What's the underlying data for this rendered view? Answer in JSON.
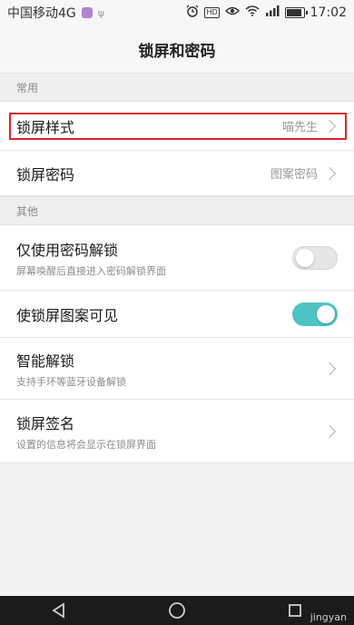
{
  "status_bar": {
    "carrier": "中国移动4G",
    "time": "17:02"
  },
  "header": {
    "title": "锁屏和密码"
  },
  "sections": {
    "common_label": "常用",
    "other_label": "其他"
  },
  "rows": {
    "lock_style": {
      "title": "锁屏样式",
      "value": "喵先生"
    },
    "lock_password": {
      "title": "锁屏密码",
      "value": "图案密码"
    },
    "password_only": {
      "title": "仅使用密码解锁",
      "subtitle": "屏幕唤醒后直接进入密码解锁界面",
      "enabled": false
    },
    "pattern_visible": {
      "title": "使锁屏图案可见",
      "enabled": true
    },
    "smart_unlock": {
      "title": "智能解锁",
      "subtitle": "支持手环等蓝牙设备解锁"
    },
    "lock_signature": {
      "title": "锁屏签名",
      "subtitle": "设置的信息将会显示在锁屏界面"
    }
  },
  "colors": {
    "toggle_on": "#4ec3c3",
    "highlight": "#e0232a"
  },
  "watermark": "jingyan"
}
